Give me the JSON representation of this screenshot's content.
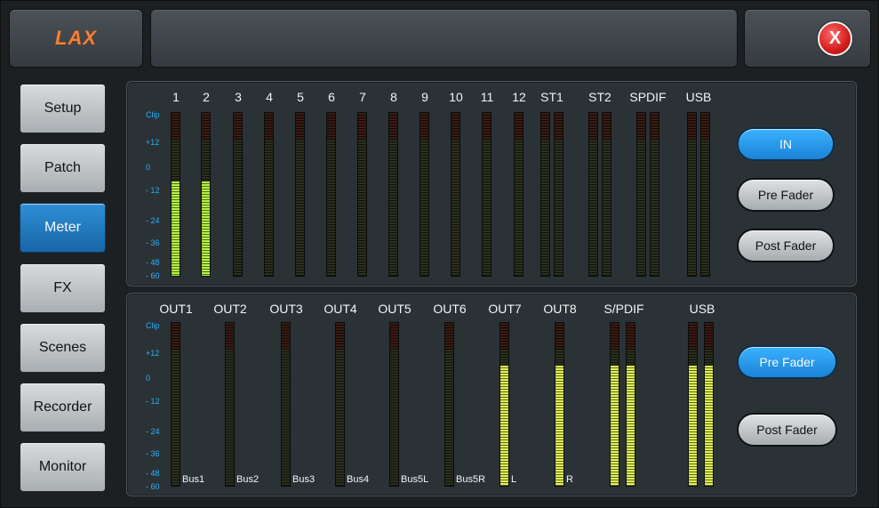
{
  "header": {
    "logo_text": "LAX",
    "close_label": "X"
  },
  "nav": {
    "items": [
      "Setup",
      "Patch",
      "Meter",
      "FX",
      "Scenes",
      "Recorder",
      "Monitor"
    ],
    "active": "Meter"
  },
  "scale_labels": [
    "Clip",
    "+12",
    "0",
    "- 12",
    "- 24",
    "- 36",
    "- 48",
    "- 60"
  ],
  "input_meters": {
    "channels": [
      "1",
      "2",
      "3",
      "4",
      "5",
      "6",
      "7",
      "8",
      "9",
      "10",
      "11",
      "12",
      "ST1",
      "ST2",
      "SPDIF",
      "USB"
    ],
    "levels": [
      0.58,
      0.58,
      0,
      0,
      0,
      0,
      0,
      0,
      0,
      0,
      0,
      0,
      0,
      0,
      0,
      0
    ],
    "buttons": [
      "IN",
      "Pre Fader",
      "Post Fader"
    ],
    "active_button": "IN"
  },
  "output_meters": {
    "channels": [
      "OUT1",
      "OUT2",
      "OUT3",
      "OUT4",
      "OUT5",
      "OUT6",
      "OUT7",
      "OUT8",
      "S/PDIF",
      "USB"
    ],
    "sources": [
      "Bus1",
      "Bus2",
      "Bus3",
      "Bus4",
      "Bus5L",
      "Bus5R",
      "L",
      "R"
    ],
    "levels": [
      0,
      0,
      0,
      0,
      0,
      0,
      0.74,
      0.74,
      0.74,
      0.74
    ],
    "buttons": [
      "Pre Fader",
      "Post Fader"
    ],
    "active_button": "Pre Fader"
  },
  "colors": {
    "accent_blue": "#2a9be8",
    "meter_green": "#b6f545",
    "close_red": "#d41d1d",
    "logo_orange": "#f0813a"
  }
}
